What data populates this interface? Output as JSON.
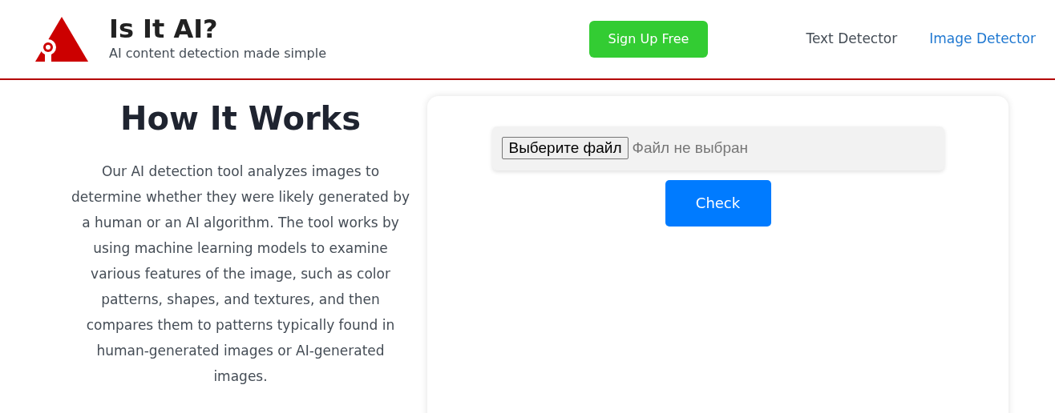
{
  "brand": {
    "title": "Is It AI?",
    "tagline": "AI content detection made simple"
  },
  "signup_button": "Sign Up Free",
  "nav": [
    {
      "label": "Text Detector",
      "selected": false
    },
    {
      "label": "Image Detector",
      "selected": true
    }
  ],
  "how_it_works": {
    "heading": "How It Works",
    "text": "Our AI detection tool analyzes images to determine whether they were likely generated by a human or an AI algorithm. The tool works by using machine learning models to examine various features of the image, such as color patterns, shapes, and textures, and then compares them to patterns typically found in human-generated images or AI-generated images."
  },
  "upload": {
    "choose_button": "Выберите файл",
    "file_status": "Файл не выбран",
    "check_button": "Check"
  }
}
